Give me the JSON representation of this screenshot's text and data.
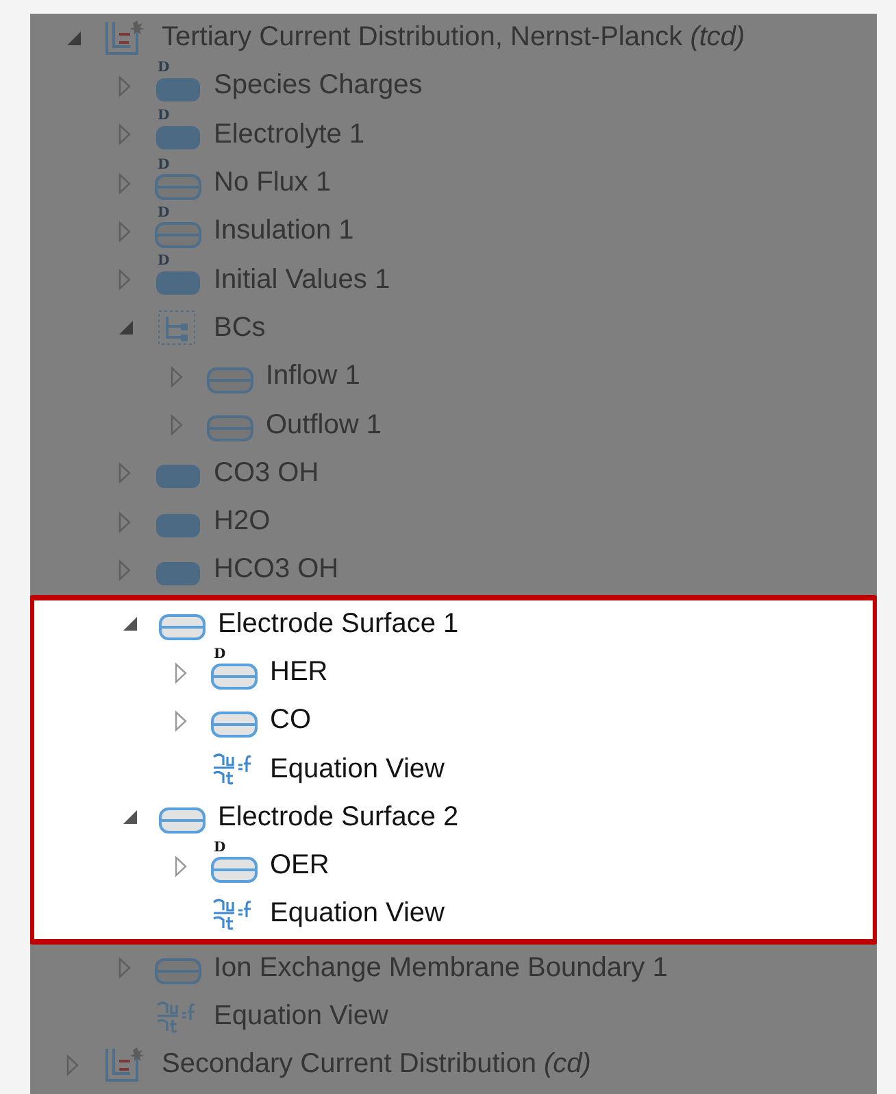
{
  "tree": [
    {
      "label": "Tertiary Current Distribution, Nernst-Planck *(tcd)*",
      "kind": "physics",
      "expanded": true,
      "dimmed": true,
      "children": [
        {
          "label": "Species Charges",
          "kind": "domain",
          "badge": "D",
          "expanded": false,
          "dimmed": true
        },
        {
          "label": "Electrolyte 1",
          "kind": "domain",
          "badge": "D",
          "expanded": false,
          "dimmed": true
        },
        {
          "label": "No Flux 1",
          "kind": "boundary",
          "badge": "D",
          "expanded": false,
          "dimmed": true
        },
        {
          "label": "Insulation 1",
          "kind": "boundary",
          "badge": "D",
          "expanded": false,
          "dimmed": true
        },
        {
          "label": "Initial Values 1",
          "kind": "domain",
          "badge": "D",
          "expanded": false,
          "dimmed": true
        },
        {
          "label": "BCs",
          "kind": "group",
          "expanded": true,
          "dimmed": true,
          "children": [
            {
              "label": "Inflow 1",
              "kind": "boundary",
              "expanded": false,
              "dimmed": true
            },
            {
              "label": "Outflow 1",
              "kind": "boundary",
              "expanded": false,
              "dimmed": true
            }
          ]
        },
        {
          "label": "CO3 OH",
          "kind": "domain",
          "expanded": false,
          "dimmed": true
        },
        {
          "label": "H2O",
          "kind": "domain",
          "expanded": false,
          "dimmed": true
        },
        {
          "label": "HCO3 OH",
          "kind": "domain",
          "expanded": false,
          "dimmed": true
        },
        {
          "label": "Electrode Surface 1",
          "kind": "boundary",
          "expanded": true,
          "dimmed": false,
          "children": [
            {
              "label": "HER",
              "kind": "boundary",
              "badge": "D",
              "expanded": false,
              "dimmed": false
            },
            {
              "label": "CO",
              "kind": "boundary",
              "expanded": false,
              "dimmed": false
            },
            {
              "label": "Equation View",
              "kind": "equation",
              "dimmed": false
            }
          ]
        },
        {
          "label": "Electrode Surface 2",
          "kind": "boundary",
          "expanded": true,
          "dimmed": false,
          "children": [
            {
              "label": "OER",
              "kind": "boundary",
              "badge": "D",
              "expanded": false,
              "dimmed": false
            },
            {
              "label": "Equation View",
              "kind": "equation",
              "dimmed": false
            }
          ]
        },
        {
          "label": "Ion Exchange Membrane Boundary 1",
          "kind": "boundary",
          "expanded": false,
          "dimmed": true
        },
        {
          "label": "Equation View",
          "kind": "equation",
          "dimmed": true
        }
      ]
    },
    {
      "label": "Secondary Current Distribution *(cd)*",
      "kind": "physics",
      "expanded": false,
      "dimmed": true
    }
  ]
}
